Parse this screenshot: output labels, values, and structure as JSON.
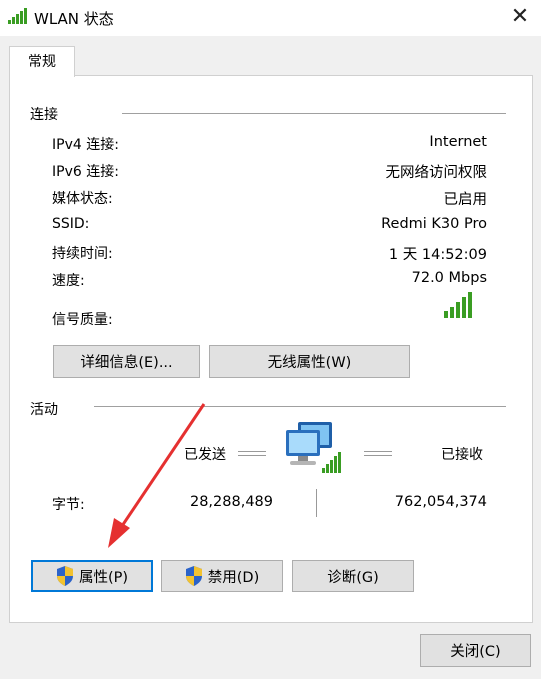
{
  "window": {
    "title": "WLAN 状态",
    "close_glyph": "✕"
  },
  "tabs": [
    {
      "label": "常规"
    }
  ],
  "connection": {
    "section_label": "连接",
    "rows": [
      {
        "label": "IPv4 连接:",
        "value": "Internet"
      },
      {
        "label": "IPv6 连接:",
        "value": "无网络访问权限"
      },
      {
        "label": "媒体状态:",
        "value": "已启用"
      },
      {
        "label": "SSID:",
        "value": "Redmi K30 Pro"
      },
      {
        "label": "持续时间:",
        "value": "1 天 14:52:09"
      },
      {
        "label": "速度:",
        "value": "72.0 Mbps"
      }
    ],
    "signal_label": "信号质量:",
    "details_button": "详细信息(E)...",
    "wireless_button": "无线属性(W)"
  },
  "activity": {
    "section_label": "活动",
    "sent_label": "已发送",
    "received_label": "已接收",
    "bytes_label": "字节:",
    "bytes_sent": "28,288,489",
    "bytes_received": "762,054,374"
  },
  "actions": {
    "properties_button": "属性(P)",
    "disable_button": "禁用(D)",
    "diagnose_button": "诊断(G)"
  },
  "footer": {
    "close_button": "关闭(C)"
  },
  "colors": {
    "accent": "#0078d7",
    "signal_green": "#3a9d23",
    "annotation_arrow": "#e53030"
  },
  "icons": [
    "wifi-signal-icon",
    "network-computers-icon",
    "shield-icon",
    "close-icon"
  ]
}
